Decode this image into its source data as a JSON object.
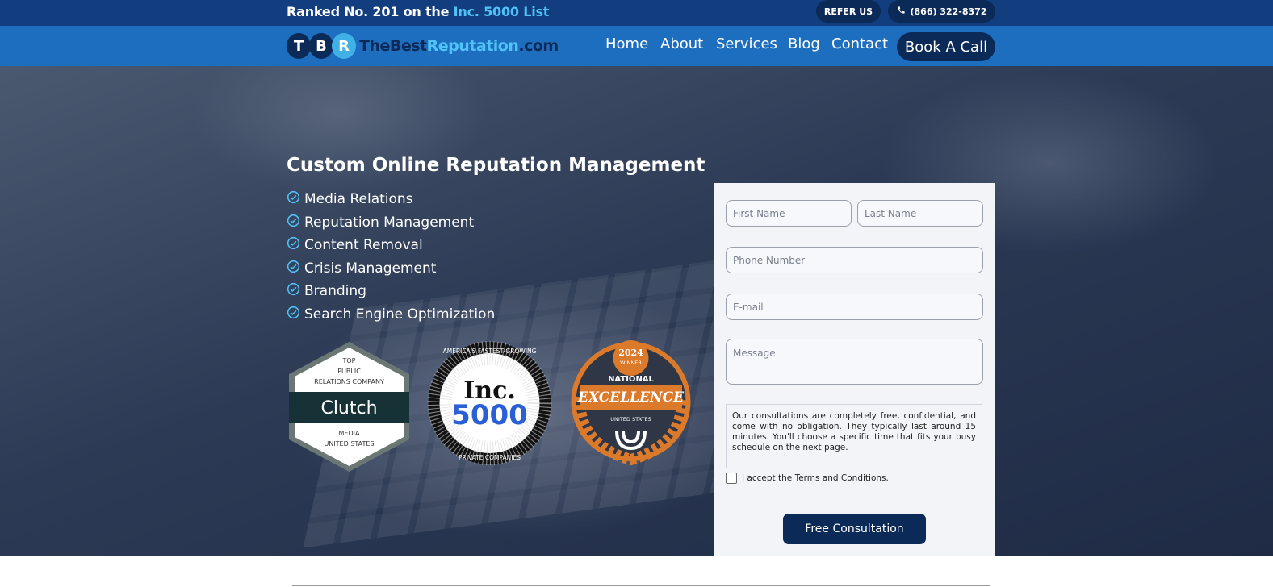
{
  "topbar": {
    "rank_prefix": "Ranked No. 201 on the",
    "rank_highlight": "Inc. 5000 List",
    "refer_label": "REFER US",
    "phone_label": "(866) 322-8372"
  },
  "logo": {
    "letters": [
      "T",
      "B",
      "R"
    ],
    "text_a": "TheBest",
    "text_b": "Reputation",
    "text_c": ".com"
  },
  "nav": {
    "items": [
      "Home",
      "About",
      "Services",
      "Blog",
      "Contact"
    ],
    "cta": "Book A Call"
  },
  "hero": {
    "title": "Custom Online Reputation Management",
    "services": [
      "Media Relations",
      "Reputation Management",
      "Content Removal",
      "Crisis Management",
      "Branding",
      "Search Engine Optimization"
    ]
  },
  "badges": {
    "clutch": {
      "top": "TOP",
      "line1": "PUBLIC",
      "line2": "RELATIONS COMPANY",
      "brand": "Clutch",
      "bottom1": "MEDIA",
      "bottom2": "UNITED STATES"
    },
    "inc": {
      "ring_top": "AMERICA'S FASTEST-GROWING",
      "brand": "Inc.",
      "number": "5000",
      "ring_bottom": "PRIVATE COMPANIES"
    },
    "upwork": {
      "year": "2024",
      "winner": "WINNER",
      "national": "NATIONAL",
      "excellence": "EXCELLENCE",
      "country": "UNITED STATES"
    }
  },
  "form": {
    "first_name_placeholder": "First Name",
    "last_name_placeholder": "Last Name",
    "phone_placeholder": "Phone Number",
    "email_placeholder": "E-mail",
    "message_placeholder": "Message",
    "disclaimer": "Our consultations are completely free, confidential, and come with no obligation. They typically last around 15 minutes. You'll choose a specific time that fits your busy schedule on the next page.",
    "terms_label": "I accept the Terms and Conditions.",
    "submit_label": "Free Consultation"
  },
  "colors": {
    "topbar": "#123d7e",
    "navbar": "#1e6ebf",
    "dark_navy": "#0c2a57",
    "accent": "#4fc3f7"
  }
}
